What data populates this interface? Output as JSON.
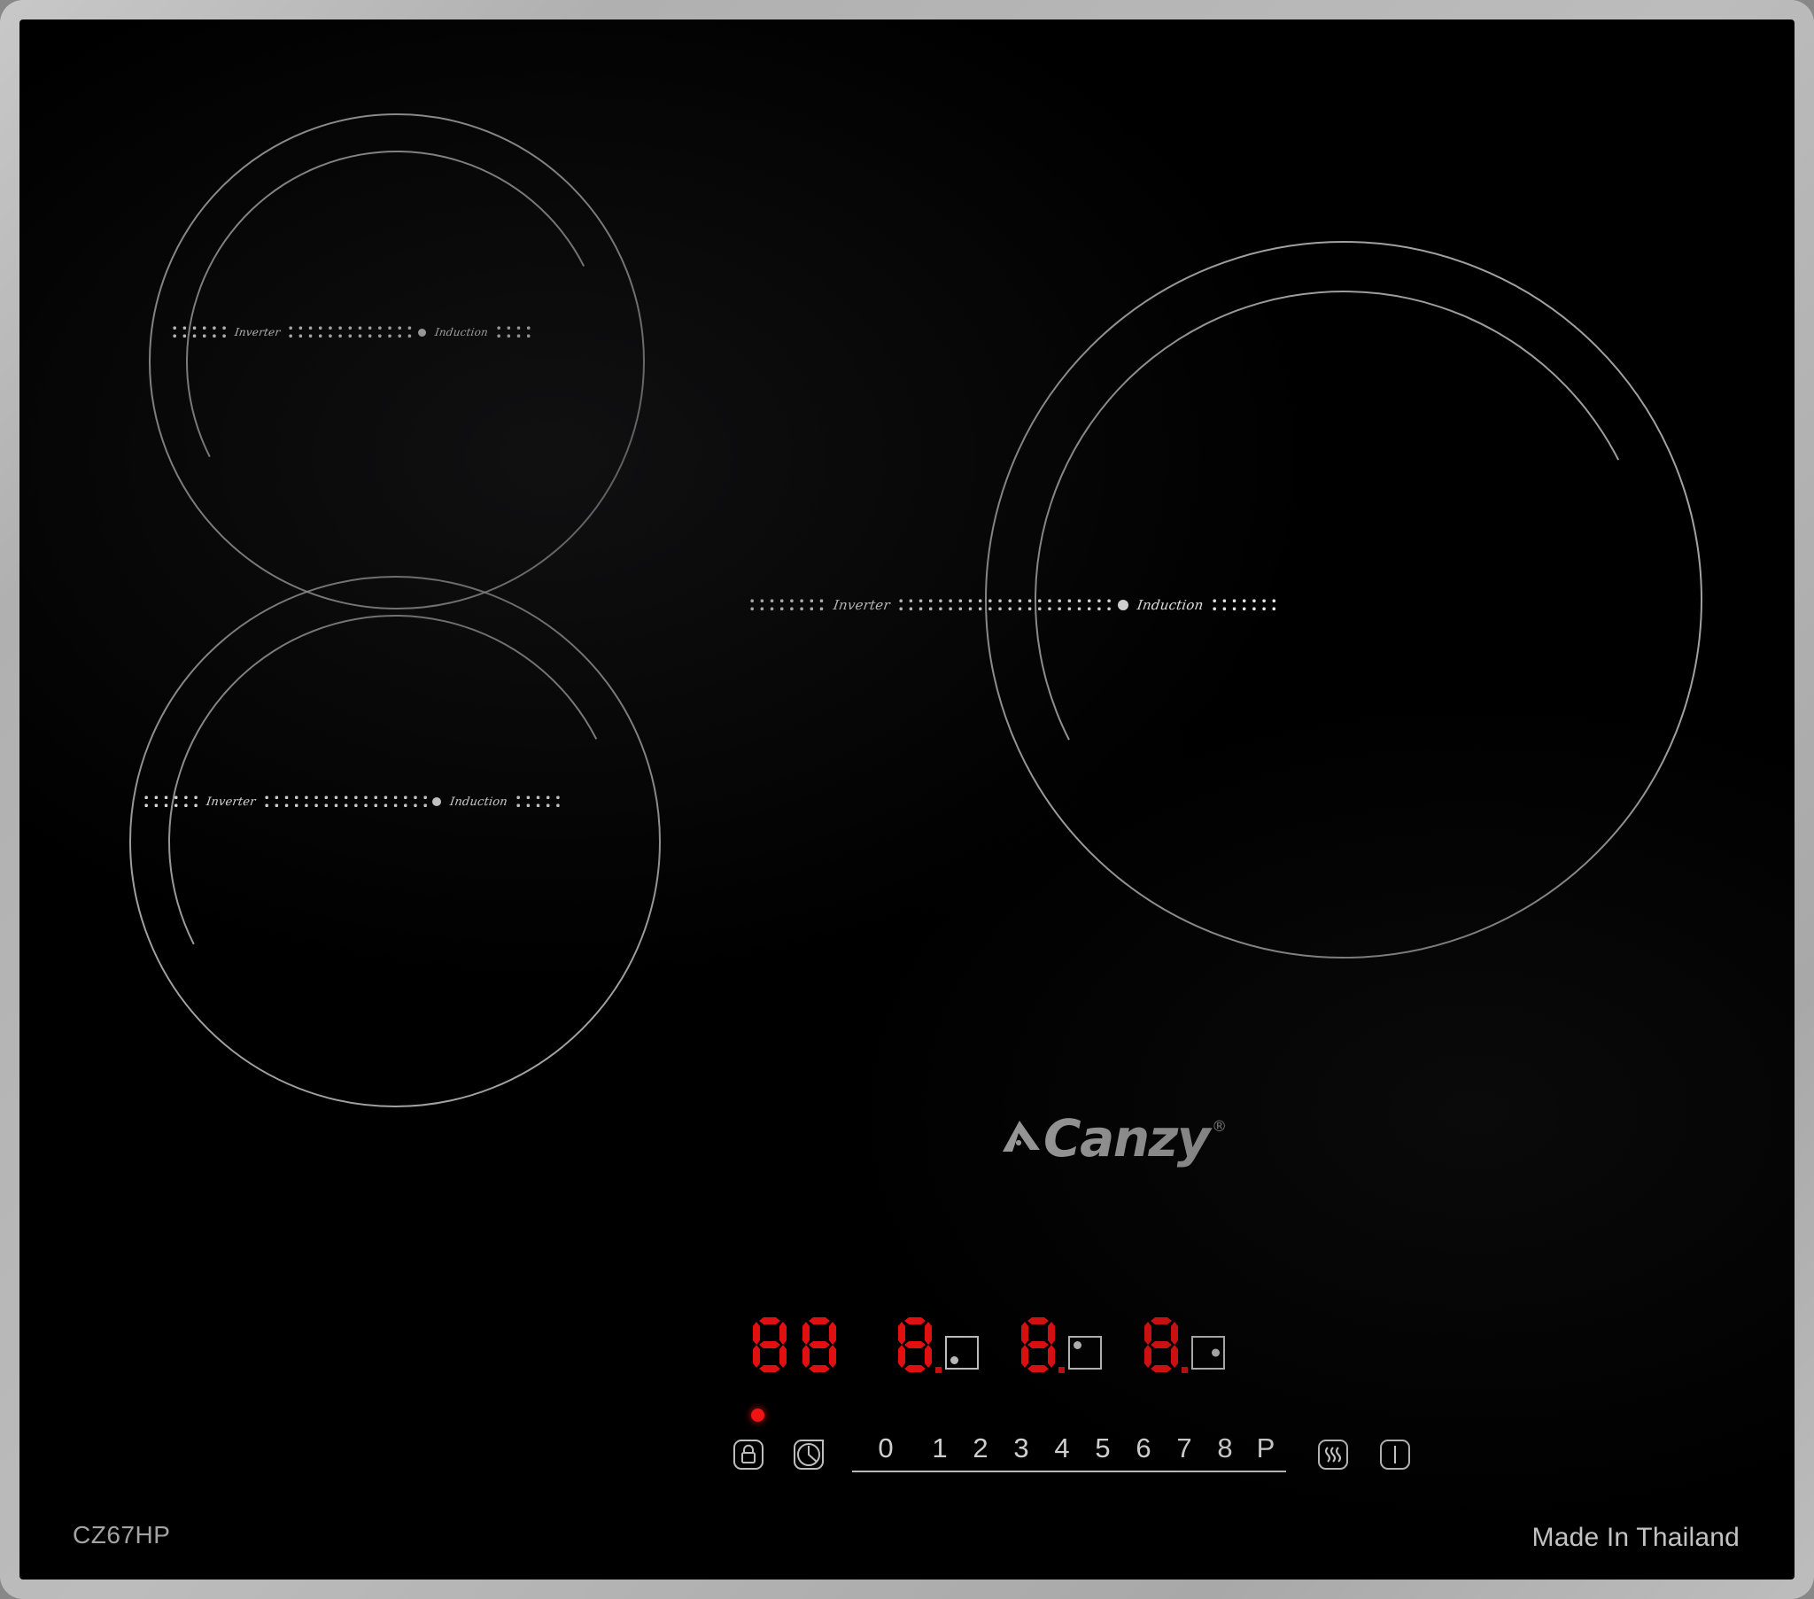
{
  "product": {
    "brand": "Canzy",
    "brand_registered_mark": "®",
    "model": "CZ67HP",
    "origin": "Made In Thailand",
    "frame_color": "#b4b4b4",
    "glass_color": "#000000",
    "led_color": "#e01010",
    "marking_color": "#c4c4c4"
  },
  "zones": [
    {
      "name": "rear-left-zone",
      "label_left": "Inverter",
      "label_right": "Induction",
      "size": "medium"
    },
    {
      "name": "front-left-zone",
      "label_left": "Inverter",
      "label_right": "Induction",
      "size": "medium"
    },
    {
      "name": "right-large-zone",
      "label_left": "Inverter",
      "label_right": "Induction",
      "size": "large"
    }
  ],
  "displays": {
    "timer": {
      "name": "timer-display",
      "value": "88",
      "digits": [
        "8",
        "8"
      ],
      "decimal_points": [
        false,
        false
      ]
    },
    "zone_displays": [
      {
        "name": "zone-display-1",
        "value": "8",
        "decimal_point": true,
        "pan_indicator": "bottom-left"
      },
      {
        "name": "zone-display-2",
        "value": "8",
        "decimal_point": true,
        "pan_indicator": "top-left"
      },
      {
        "name": "zone-display-3",
        "value": "8",
        "decimal_point": true,
        "pan_indicator": "center-right"
      }
    ]
  },
  "controls": {
    "power_led": {
      "name": "power-indicator-led",
      "color": "#ee1414",
      "state": "on"
    },
    "lock_button": {
      "name": "child-lock-button",
      "icon": "padlock-icon"
    },
    "timer_button": {
      "name": "timer-button",
      "icon": "clock-icon"
    },
    "slider": {
      "name": "power-level-slider",
      "levels": [
        "0",
        "1",
        "2",
        "3",
        "4",
        "5",
        "6",
        "7",
        "8",
        "P"
      ]
    },
    "keep_warm_button": {
      "name": "keep-warm-button",
      "icon": "heat-waves-icon"
    },
    "on_off_button": {
      "name": "on-off-button",
      "icon": "power-icon"
    }
  }
}
